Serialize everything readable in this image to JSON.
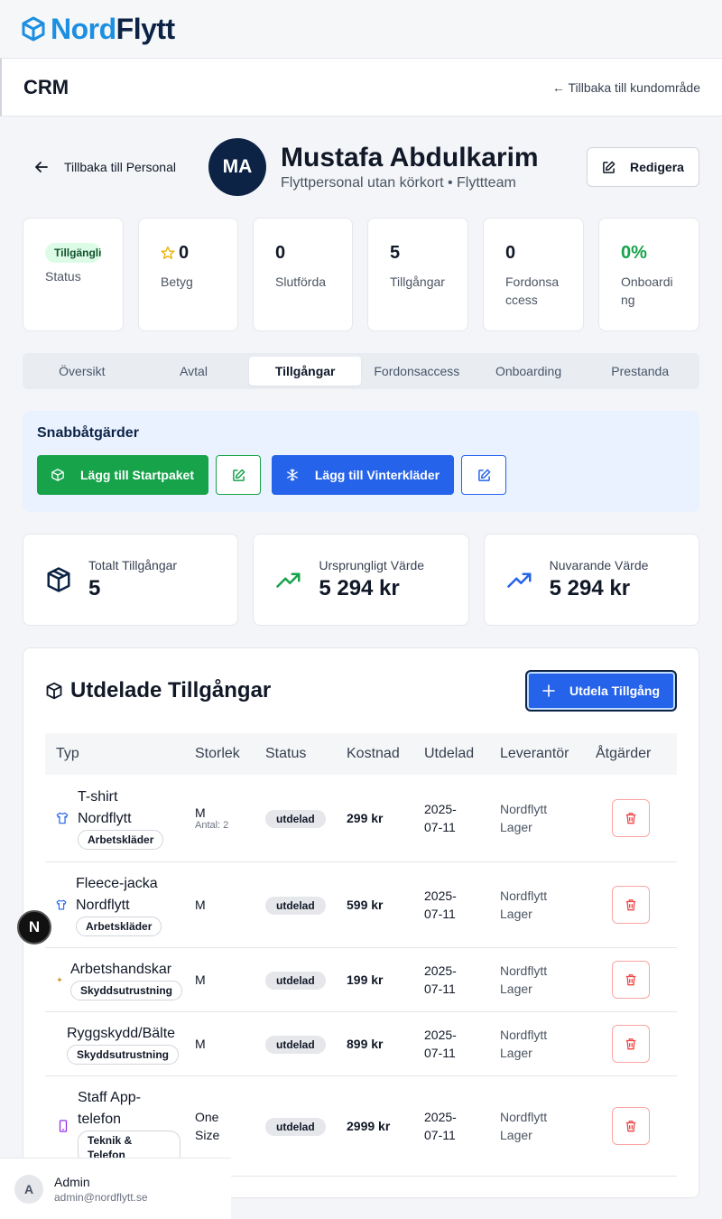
{
  "brand": {
    "part1": "Nord",
    "part2": "Flytt",
    "icon": "box-icon"
  },
  "header": {
    "title": "CRM",
    "back_link": "← Tillbaka till kundområde"
  },
  "profile": {
    "back_label": "Tillbaka till Personal",
    "initials": "MA",
    "name": "Mustafa Abdulkarim",
    "role": "Flyttpersonal utan körkort • Flyttteam",
    "edit_label": "Redigera"
  },
  "stats": {
    "status_badge": "Tillgänglig",
    "status_label": "Status",
    "rating_value": "0",
    "rating_label": "Betyg",
    "completed_value": "0",
    "completed_label": "Slutförda",
    "assets_value": "5",
    "assets_label": "Tillgångar",
    "vehicle_value": "0",
    "vehicle_label": "Fordonsaccess",
    "onboarding_value": "0%",
    "onboarding_label": "Onboarding"
  },
  "tabs": [
    "Översikt",
    "Avtal",
    "Tillgångar",
    "Fordonsaccess",
    "Onboarding",
    "Prestanda"
  ],
  "active_tab": "Tillgångar",
  "quick_actions": {
    "title": "Snabbåtgärder",
    "starter_label": "Lägg till Startpaket",
    "winter_label": "Lägg till Vinterkläder"
  },
  "summary": {
    "total_label": "Totalt Tillgångar",
    "total_value": "5",
    "original_label": "Ursprungligt Värde",
    "original_value": "5 294 kr",
    "current_label": "Nuvarande Värde",
    "current_value": "5 294 kr"
  },
  "assets": {
    "title": "Utdelade Tillgångar",
    "add_label": "Utdela Tillgång",
    "columns": [
      "Typ",
      "Storlek",
      "Status",
      "Kostnad",
      "Utdelad",
      "Leverantör",
      "Åtgärder"
    ],
    "rows": [
      {
        "name": "T-shirt Nordflytt",
        "category": "Arbetskläder",
        "size": "M",
        "qty": "Antal: 2",
        "status": "utdelad",
        "cost": "299 kr",
        "date": "2025-07-11",
        "supplier": "Nordflytt Lager"
      },
      {
        "name": "Fleece-jacka Nordflytt",
        "category": "Arbetskläder",
        "size": "M",
        "qty": "",
        "status": "utdelad",
        "cost": "599 kr",
        "date": "2025-07-11",
        "supplier": "Nordflytt Lager"
      },
      {
        "name": "Arbetshandskar",
        "category": "Skyddsutrustning",
        "size": "M",
        "qty": "",
        "status": "utdelad",
        "cost": "199 kr",
        "date": "2025-07-11",
        "supplier": "Nordflytt Lager"
      },
      {
        "name": "Ryggskydd/Bälte",
        "category": "Skyddsutrustning",
        "size": "M",
        "qty": "",
        "status": "utdelad",
        "cost": "899 kr",
        "date": "2025-07-11",
        "supplier": "Nordflytt Lager"
      },
      {
        "name": "Staff App-telefon",
        "category": "Teknik & Telefon",
        "size": "One Size",
        "qty": "",
        "status": "utdelad",
        "cost": "2999 kr",
        "date": "2025-07-11",
        "supplier": "Nordflytt Lager"
      }
    ]
  },
  "overlay": {
    "bubble_letter": "N"
  },
  "user": {
    "initial": "A",
    "name": "Admin",
    "email": "admin@nordflytt.se"
  },
  "colors": {
    "brand_blue": "#1d8fe0",
    "brand_navy": "#0d2346",
    "green": "#16a34a",
    "blue": "#2563eb",
    "danger": "#ef4444"
  }
}
